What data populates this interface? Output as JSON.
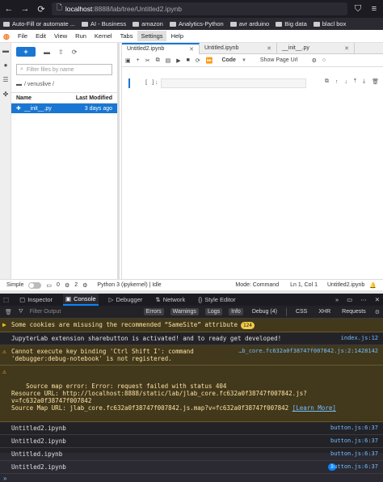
{
  "browser": {
    "url_host": "localhost",
    "url_path": ":8888/lab/tree/Untitled2.ipynb",
    "bookmarks": [
      "Auto-Fill or automate ...",
      "AI - Business",
      "amazon",
      "Analytics-Python",
      "avr arduino",
      "Big data",
      "blacl box"
    ]
  },
  "jupyter": {
    "menu": [
      "File",
      "Edit",
      "View",
      "Run",
      "Kernel",
      "Tabs",
      "Settings",
      "Help"
    ],
    "active_menu": "Settings",
    "filebrowser": {
      "new_label": "+",
      "filter_placeholder": "Filter files by name",
      "breadcrumb": "/ venuslive /",
      "col_name": "Name",
      "col_modified": "Last Modified",
      "file_name": "__init__.py",
      "file_modified": "3 days ago"
    },
    "tabs": [
      "Untitled2.ipynb",
      "Untitled.ipynb",
      "__init__.py"
    ],
    "toolbar": {
      "cell_type": "Code",
      "show_page": "Show Page Url"
    },
    "cell": {
      "prompt": "[ ]:"
    },
    "status": {
      "mode_label": "Simple",
      "zero_count": "0",
      "two_count": "2",
      "kernel": "Python 3 (ipykernel) | Idle",
      "mode": "Mode: Command",
      "cursor": "Ln 1, Col 1",
      "file": "Untitled2.ipynb"
    }
  },
  "devtools": {
    "tabs": [
      "Inspector",
      "Console",
      "Debugger",
      "Network",
      "Style Editor"
    ],
    "active_tab": "Console",
    "filter_placeholder": "Filter Output",
    "categories": [
      "Errors",
      "Warnings",
      "Logs",
      "Info",
      "Debug (4)"
    ],
    "extra": [
      "CSS",
      "XHR",
      "Requests"
    ],
    "messages": [
      {
        "type": "warn",
        "text": "Some cookies are misusing the recommended “SameSite” attribute",
        "count": "124",
        "source": ""
      },
      {
        "type": "log",
        "text": "JupyterLab extension sharebutton is activated! and to ready get developed!",
        "source": "index.js:12"
      },
      {
        "type": "warn",
        "text": "Cannot execute key binding 'Ctrl Shift I': command 'debugger:debug-notebook' is not registered.",
        "source": "…b_core.fc632a0f38747f007842.js:2:1428142"
      },
      {
        "type": "warn",
        "text": "Source map error: Error: request failed with status 404\nResource URL: http://localhost:8888/static/lab/jlab_core.fc632a0f38747f007842.js?v=fc632a0f38747f007842\nSource Map URL: jlab_core.fc632a0f38747f007842.js.map?v=fc632a0f38747f007842",
        "link": "[Learn More]",
        "source": ""
      },
      {
        "type": "log",
        "text": "Untitled2.ipynb",
        "source": "button.js:6:37"
      },
      {
        "type": "log",
        "text": "Untitled2.ipynb",
        "source": "button.js:6:37"
      },
      {
        "type": "log",
        "text": "Untitled.ipynb",
        "source": "button.js:6:37"
      },
      {
        "type": "log",
        "text": "Untitled2.ipynb",
        "count": "2",
        "source": "button.js:6:37"
      }
    ]
  }
}
